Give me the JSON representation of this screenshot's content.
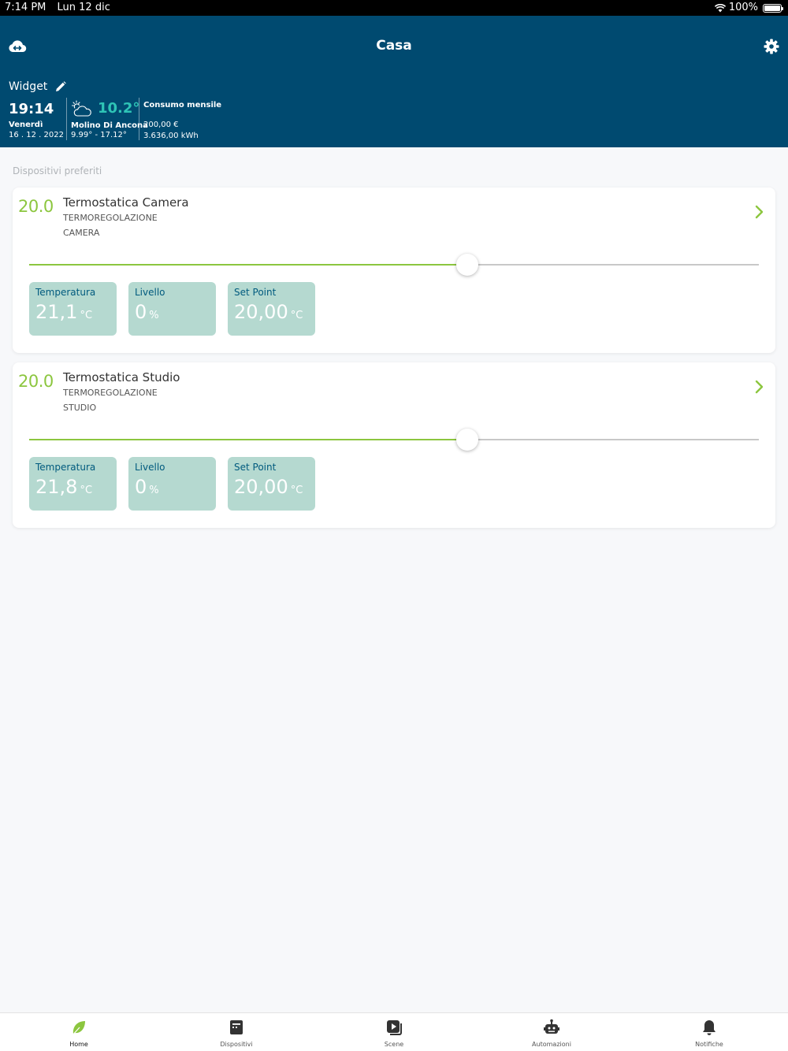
{
  "status_bar": {
    "time": "7:14 PM",
    "date": "Lun 12 dic",
    "battery": "100%"
  },
  "header": {
    "title": "Casa",
    "icons": {
      "left": "cloud-sync-icon",
      "right": "gear-icon"
    }
  },
  "widget": {
    "label": "Widget",
    "time": "19:14",
    "day": "Venerdì",
    "date": "16 . 12 . 2022",
    "temperature": "10.2°",
    "city": "Molino Di Ancona",
    "range": "9.99° - 17.12°",
    "consumption_title": "Consumo mensile",
    "consumption_money": "200,00 €",
    "consumption_energy": "3.636,00 kWh"
  },
  "favorites": {
    "title": "Dispositivi preferiti",
    "devices": [
      {
        "value": "20.0",
        "name": "Termostatica Camera",
        "category": "TERMOREGOLAZIONE",
        "room": "CAMERA",
        "slider_fraction": 0.6,
        "tiles": [
          {
            "label": "Temperatura",
            "value": "21,1",
            "unit": "°C"
          },
          {
            "label": "Livello",
            "value": "0",
            "unit": "%"
          },
          {
            "label": "Set Point",
            "value": "20,00",
            "unit": "°C"
          }
        ]
      },
      {
        "value": "20.0",
        "name": "Termostatica Studio",
        "category": "TERMOREGOLAZIONE",
        "room": "STUDIO",
        "slider_fraction": 0.6,
        "tiles": [
          {
            "label": "Temperatura",
            "value": "21,8",
            "unit": "°C"
          },
          {
            "label": "Livello",
            "value": "0",
            "unit": "%"
          },
          {
            "label": "Set Point",
            "value": "20,00",
            "unit": "°C"
          }
        ]
      }
    ]
  },
  "tabbar": {
    "tabs": [
      {
        "label": "Home",
        "icon": "leaf-icon",
        "active": true
      },
      {
        "label": "Dispositivi",
        "icon": "device-icon",
        "active": false
      },
      {
        "label": "Scene",
        "icon": "scene-play-icon",
        "active": false
      },
      {
        "label": "Automazioni",
        "icon": "robot-icon",
        "active": false
      },
      {
        "label": "Notifiche",
        "icon": "bell-icon",
        "active": false
      }
    ]
  },
  "colors": {
    "header_bg": "#004a70",
    "accent_green": "#8cc63f",
    "weather_temp": "#2ec4b6",
    "tile_bg": "#b5d9d0",
    "tile_label": "#005a7e"
  }
}
